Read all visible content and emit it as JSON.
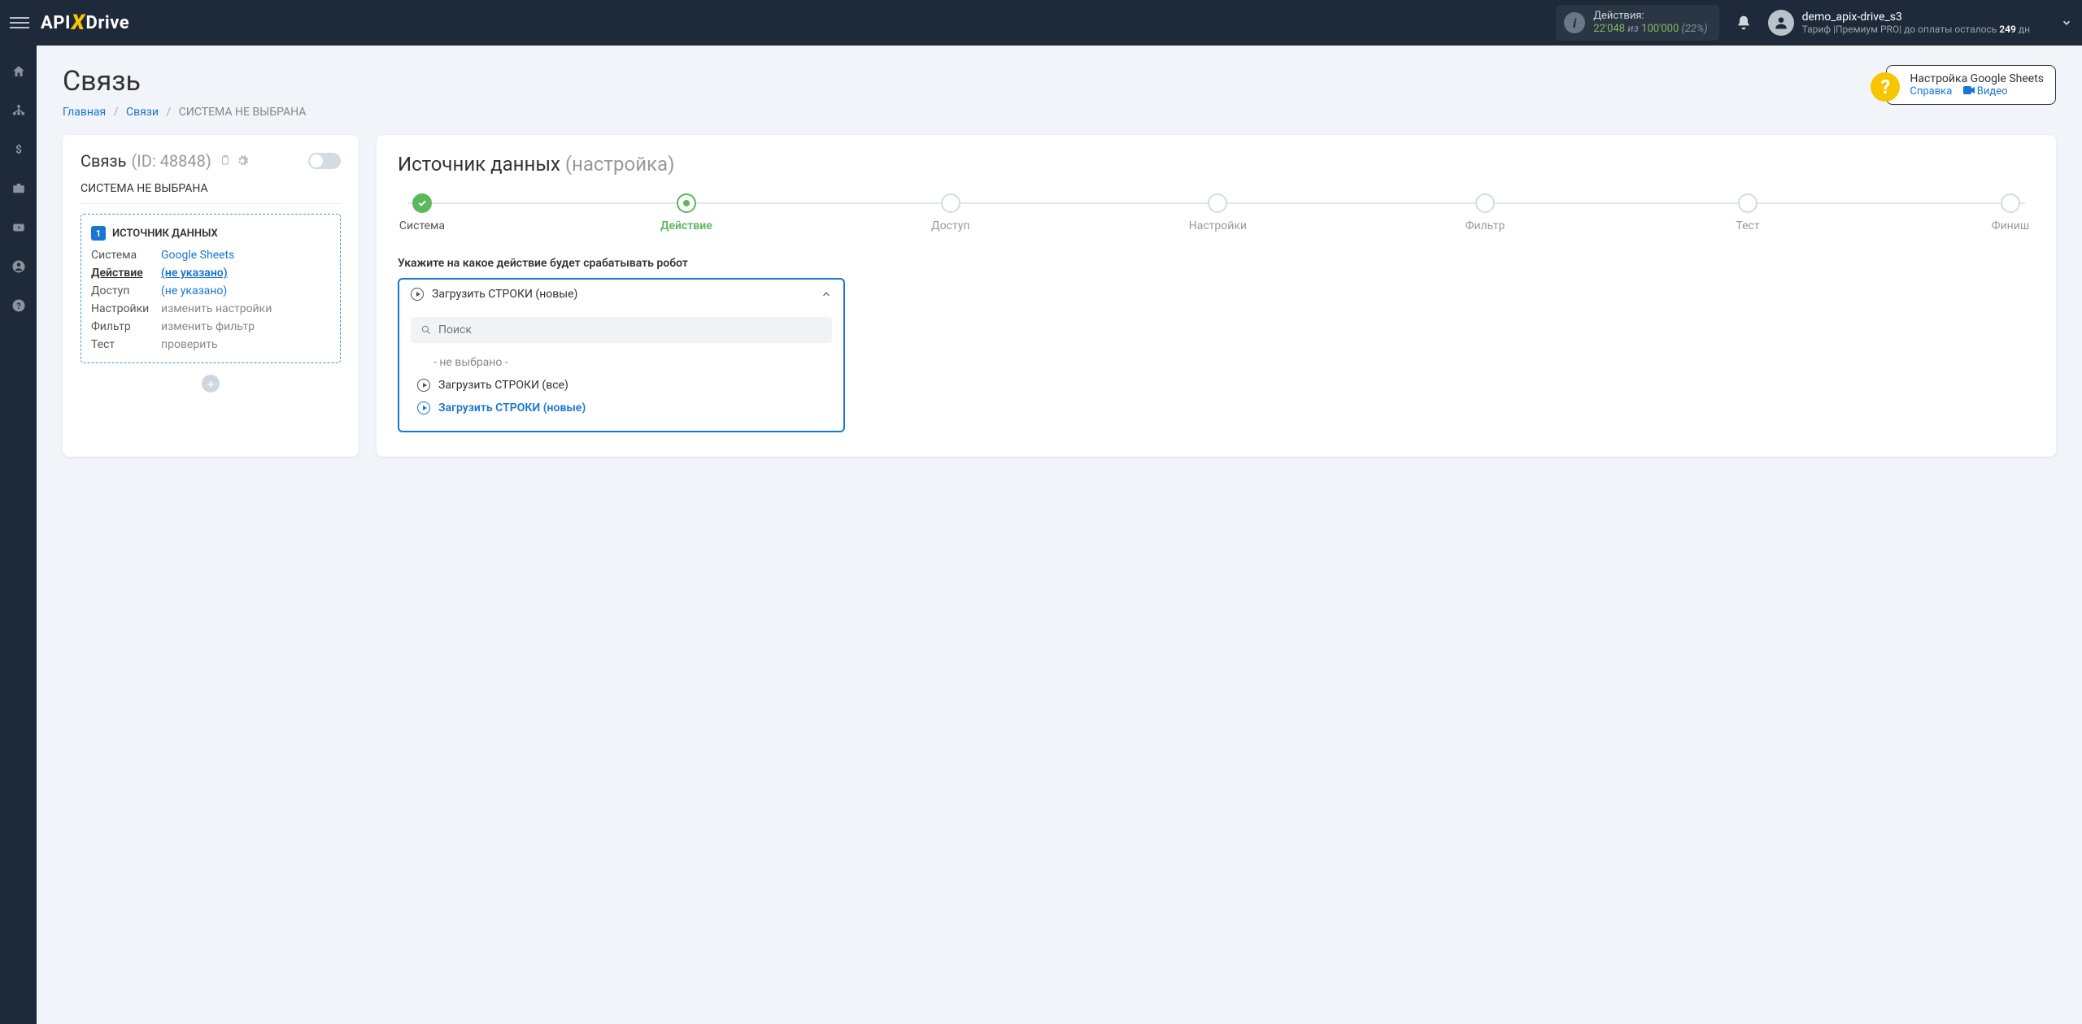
{
  "topbar": {
    "logo_left": "API",
    "logo_right": "Drive",
    "actions_label": "Действия:",
    "actions_used": "22'048",
    "actions_of": "из",
    "actions_total": "100'000",
    "actions_pct": "(22%)",
    "username": "demo_apix-drive_s3",
    "tariff_prefix": "Тариф ",
    "tariff_name": "|Премиум PRO|",
    "days_prefix": " до оплаты осталось ",
    "days_left": "249",
    "days_suffix": " дн"
  },
  "page": {
    "title": "Связь",
    "breadcrumb": {
      "home": "Главная",
      "links": "Связи",
      "current": "СИСТЕМА НЕ ВЫБРАНА"
    }
  },
  "help": {
    "title": "Настройка Google Sheets",
    "link1": "Справка",
    "link2": "Видео"
  },
  "left": {
    "title": "Связь",
    "id": "(ID: 48848)",
    "sub": "СИСТЕМА НЕ ВЫБРАНА",
    "source_heading": "ИСТОЧНИК ДАННЫХ",
    "rows": {
      "system_k": "Система",
      "system_v": "Google Sheets",
      "action_k": "Действие",
      "action_v": "(не указано)",
      "access_k": "Доступ",
      "access_v": "(не указано)",
      "settings_k": "Настройки",
      "settings_v": "изменить настройки",
      "filter_k": "Фильтр",
      "filter_v": "изменить фильтр",
      "test_k": "Тест",
      "test_v": "проверить"
    }
  },
  "right": {
    "title": "Источник данных",
    "subtitle": "(настройка)",
    "steps": [
      "Система",
      "Действие",
      "Доступ",
      "Настройки",
      "Фильтр",
      "Тест",
      "Финиш"
    ],
    "field_label": "Укажите на какое действие будет срабатывать робот",
    "dd_selected": "Загрузить СТРОКИ (новые)",
    "dd_search_ph": "Поиск",
    "dd_opt_none": "- не выбрано -",
    "dd_opt_all": "Загрузить СТРОКИ (все)",
    "dd_opt_new": "Загрузить СТРОКИ (новые)"
  }
}
